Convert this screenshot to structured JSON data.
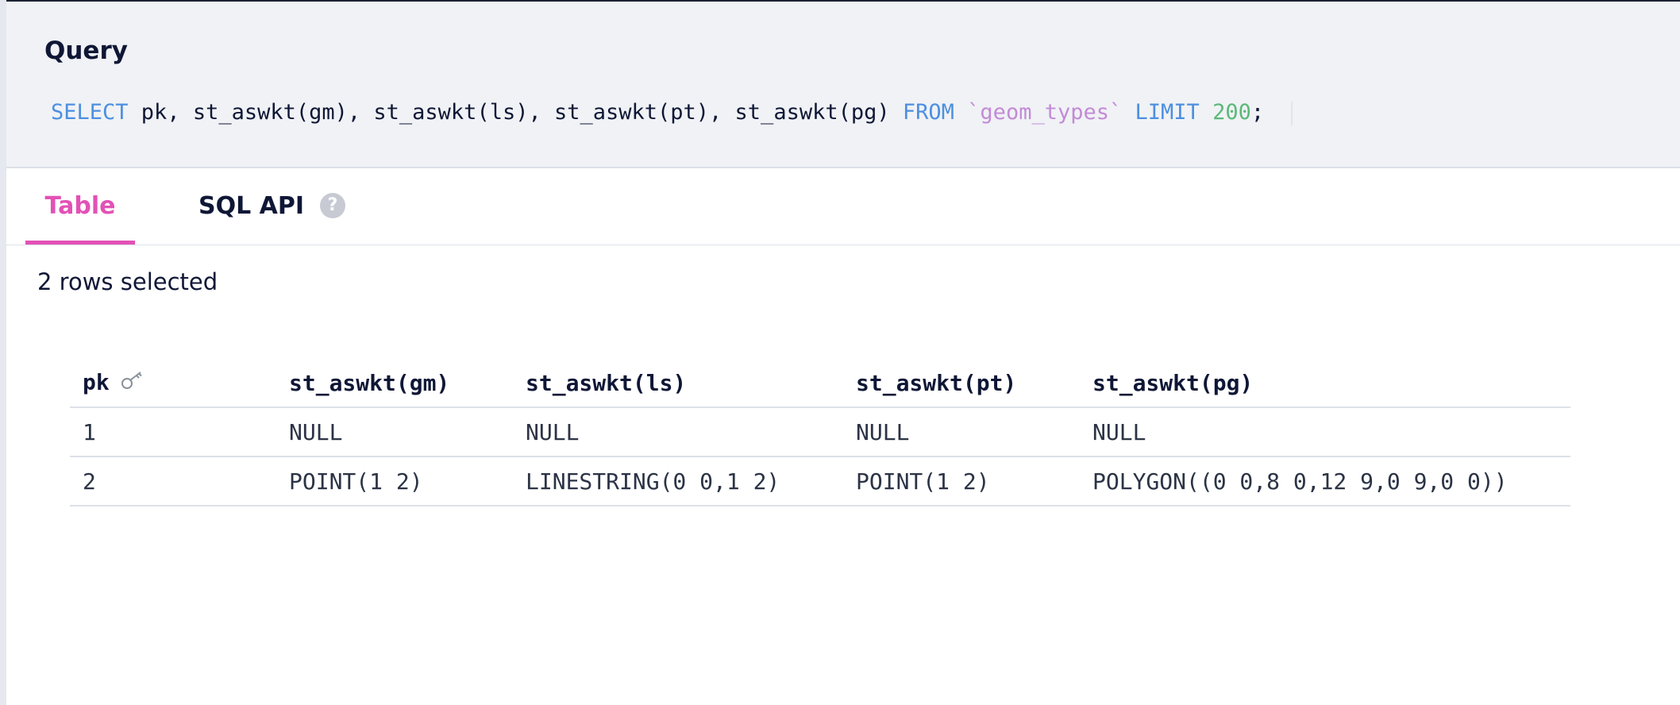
{
  "query": {
    "title": "Query",
    "sql": {
      "select": "SELECT",
      "columns": " pk, st_aswkt(gm), st_aswkt(ls), st_aswkt(pt), st_aswkt(pg) ",
      "from": "FROM",
      "table": "`geom_types`",
      "limit": "LIMIT",
      "limit_value": "200",
      "terminator": ";"
    }
  },
  "tabs": [
    {
      "label": "Table",
      "active": true
    },
    {
      "label": "SQL API",
      "active": false,
      "help_icon": "question-mark-icon",
      "help_text": "?"
    }
  ],
  "status": {
    "rows_selected": "2 rows selected"
  },
  "results": {
    "columns": [
      "pk",
      "st_aswkt(gm)",
      "st_aswkt(ls)",
      "st_aswkt(pt)",
      "st_aswkt(pg)"
    ],
    "pk_icon": "key-icon",
    "rows": [
      [
        "1",
        "NULL",
        "NULL",
        "NULL",
        "NULL"
      ],
      [
        "2",
        "POINT(1 2)",
        "LINESTRING(0 0,1 2)",
        "POINT(1 2)",
        "POLYGON((0 0,8 0,12 9,0 9,0 0))"
      ]
    ]
  },
  "colors": {
    "accent": "#e351b5",
    "keyword": "#4c8fe0",
    "table_name": "#c38ad7",
    "number": "#5cb87a",
    "null_text": "#a8afb8"
  }
}
